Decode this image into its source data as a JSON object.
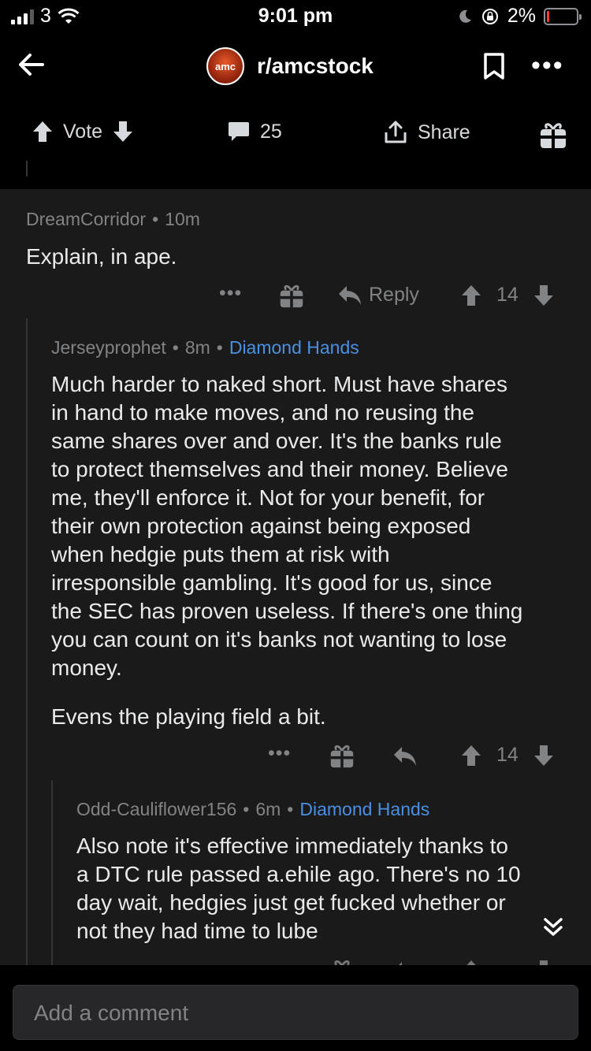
{
  "status_bar": {
    "carrier": "3",
    "time": "9:01 pm",
    "battery": "2%"
  },
  "header": {
    "subreddit": "r/amcstock",
    "avatar_text": "amc"
  },
  "post_actions": {
    "vote_label": "Vote",
    "comments_count": "25",
    "share_label": "Share"
  },
  "comments": [
    {
      "author": "DreamCorridor",
      "age": "10m",
      "flair": "",
      "body": "Explain, in ape.",
      "reply_label": "Reply",
      "score": "14"
    },
    {
      "author": "Jerseyprophet",
      "age": "8m",
      "flair": "Diamond Hands",
      "body_lines": [
        "Much harder to naked short. Must have shares",
        "in hand to make moves, and no reusing the",
        "same shares over and over. It's the banks rule",
        "to protect themselves and their money. Believe",
        "me, they'll enforce it. Not for your benefit, for",
        "their own protection against being exposed",
        "when hedgie puts them at risk with",
        "irresponsible gambling. It's good for us, since",
        "the SEC has proven useless. If there's one thing",
        "you can count on it's banks not wanting to lose",
        "money."
      ],
      "body_p2": "Evens the playing field a bit.",
      "score": "14"
    },
    {
      "author": "Odd-Cauliflower156",
      "age": "6m",
      "flair": "Diamond Hands",
      "body_lines": [
        "Also note it's effective immediately thanks to",
        "a DTC rule passed a.ehile ago. There's no 10",
        "day wait, hedgies just get fucked whether or",
        "not they had time to lube"
      ]
    }
  ],
  "composer": {
    "placeholder": "Add a comment"
  }
}
